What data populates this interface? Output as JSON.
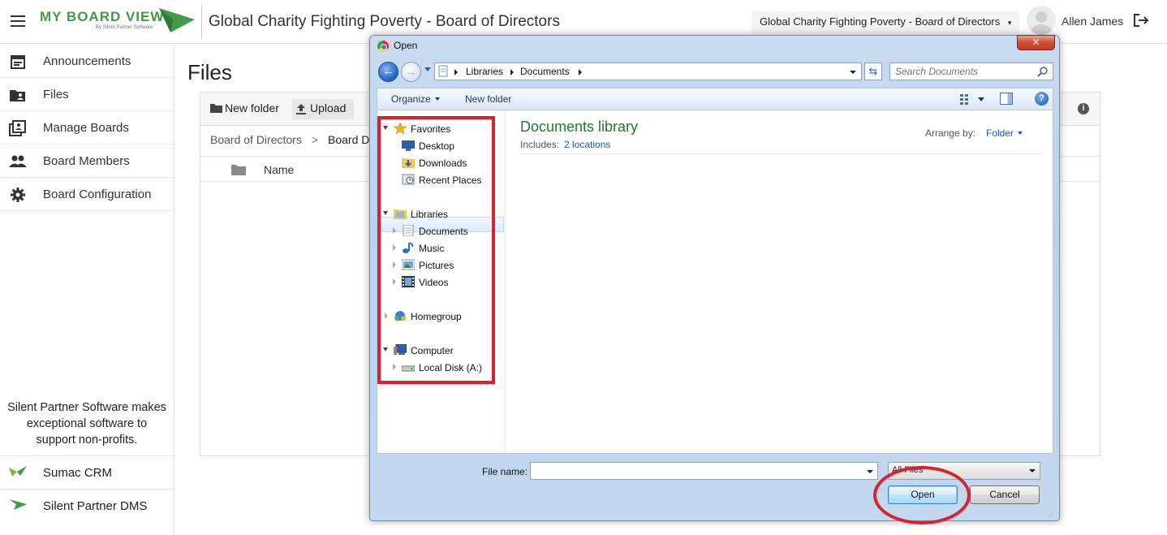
{
  "header": {
    "logo_text": "MY BOARD VIEW",
    "logo_sub": "By Silent Partner Software",
    "org_title": "Global Charity Fighting Poverty - Board of Directors",
    "board_select": "Global Charity Fighting Poverty - Board of Directors",
    "user_name": "Allen James"
  },
  "sidebar": {
    "items": [
      {
        "label": "Announcements",
        "icon": "calendar-icon"
      },
      {
        "label": "Files",
        "icon": "folder-user-icon"
      },
      {
        "label": "Manage Boards",
        "icon": "boards-icon"
      },
      {
        "label": "Board Members",
        "icon": "people-icon"
      },
      {
        "label": "Board Configuration",
        "icon": "gear-icon"
      }
    ],
    "promo": "Silent Partner Software makes exceptional software to support non-profits.",
    "products": [
      {
        "label": "Sumac CRM"
      },
      {
        "label": "Silent Partner DMS"
      }
    ]
  },
  "main": {
    "title": "Files",
    "toolbar": {
      "new_folder": "New folder",
      "upload": "Upload"
    },
    "breadcrumb": [
      "Board of Directors",
      "Board D"
    ],
    "columns": {
      "name": "Name"
    }
  },
  "dialog": {
    "title": "Open",
    "address": [
      "Libraries",
      "Documents"
    ],
    "search_placeholder": "Search Documents",
    "commands": {
      "organize": "Organize",
      "new_folder": "New folder"
    },
    "tree": {
      "favorites": "Favorites",
      "desktop": "Desktop",
      "downloads": "Downloads",
      "recent": "Recent Places",
      "libraries": "Libraries",
      "documents": "Documents",
      "music": "Music",
      "pictures": "Pictures",
      "videos": "Videos",
      "homegroup": "Homegroup",
      "computer": "Computer",
      "local_disk": "Local Disk (A:)"
    },
    "library_title": "Documents library",
    "includes_label": "Includes:",
    "includes_value": "2 locations",
    "arrange_label": "Arrange by:",
    "arrange_value": "Folder",
    "file_name_label": "File name:",
    "file_name_value": "",
    "filter_value": "All Files",
    "open_button": "Open",
    "cancel_button": "Cancel"
  },
  "colors": {
    "brand_green": "#3f9b46",
    "annotation_red": "#d8222f",
    "win_selection": "#dbeafd"
  }
}
